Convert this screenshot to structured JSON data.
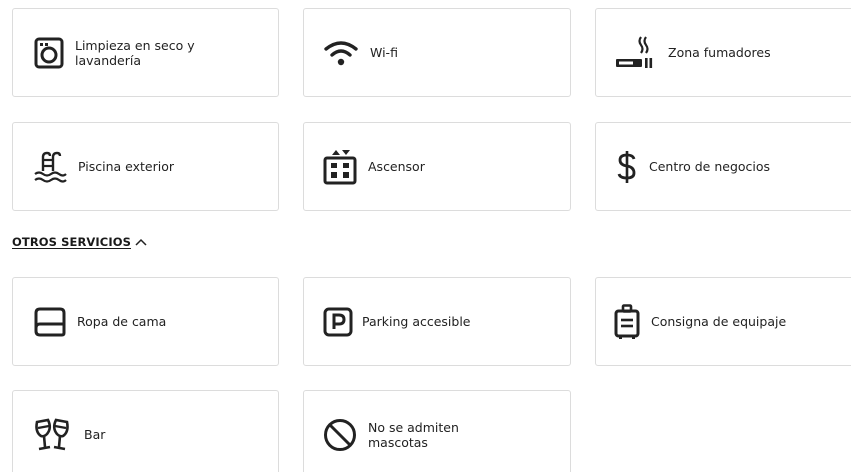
{
  "top_amenities": [
    {
      "label": "Limpieza en seco y\nlavandería",
      "icon": "washing-machine-icon"
    },
    {
      "label": "Wi-fi",
      "icon": "wifi-icon"
    },
    {
      "label": "Zona fumadores",
      "icon": "smoking-icon"
    },
    {
      "label": "Piscina exterior",
      "icon": "pool-icon"
    },
    {
      "label": "Ascensor",
      "icon": "elevator-icon"
    },
    {
      "label": "Centro de negocios",
      "icon": "dollar-icon"
    }
  ],
  "other_services": {
    "title": "OTROS SERVICIOS",
    "expanded": true,
    "toggle_icon": "chevron-up-icon",
    "items": [
      {
        "label": "Ropa de cama",
        "icon": "bed-linen-icon"
      },
      {
        "label": "Parking accesible",
        "icon": "parking-icon"
      },
      {
        "label": "Consigna de equipaje",
        "icon": "luggage-icon"
      },
      {
        "label": "Bar",
        "icon": "cheers-glasses-icon"
      },
      {
        "label": "No se admiten\nmascotas",
        "icon": "no-pets-icon"
      }
    ]
  }
}
